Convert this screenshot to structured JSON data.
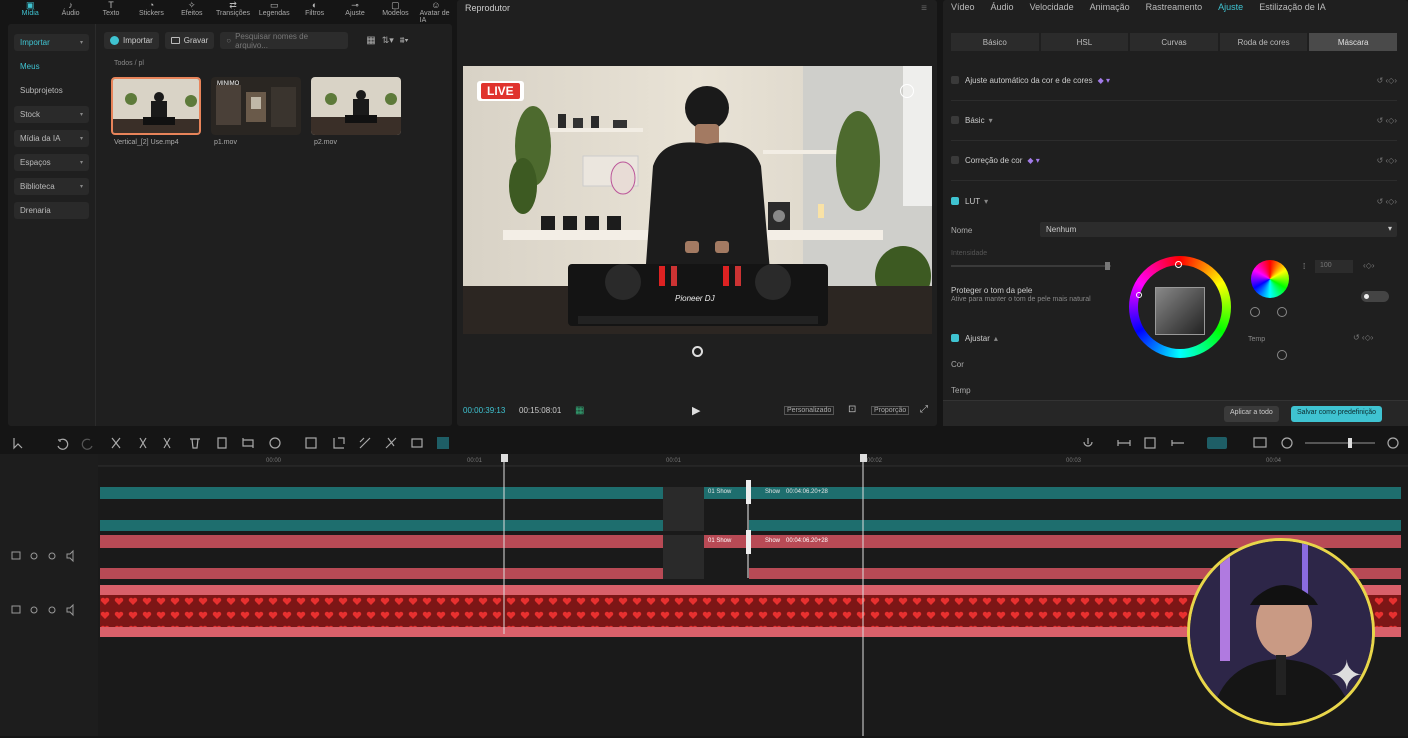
{
  "top_tools": [
    {
      "label": "Mídia",
      "icon": "media-icon",
      "active": true
    },
    {
      "label": "Áudio",
      "icon": "audio-icon"
    },
    {
      "label": "Texto",
      "icon": "text-icon"
    },
    {
      "label": "Stickers",
      "icon": "sticker-icon"
    },
    {
      "label": "Efeitos",
      "icon": "effects-icon"
    },
    {
      "label": "Transições",
      "icon": "transitions-icon"
    },
    {
      "label": "Legendas",
      "icon": "captions-icon"
    },
    {
      "label": "Filtros",
      "icon": "filters-icon"
    },
    {
      "label": "Ajuste",
      "icon": "adjust-icon"
    },
    {
      "label": "Modelos",
      "icon": "templates-icon"
    },
    {
      "label": "Avatar de IA",
      "icon": "ai-avatar-icon"
    }
  ],
  "media_sidebar": [
    {
      "label": "Importar",
      "active": true,
      "box": true,
      "arrow": true
    },
    {
      "label": "Meus",
      "active": true,
      "box": false
    },
    {
      "label": "Subprojetos",
      "box": false
    },
    {
      "label": "Stock",
      "box": true,
      "arrow": true
    },
    {
      "label": "Mídia da IA",
      "box": true,
      "arrow": true
    },
    {
      "label": "Espaços",
      "box": true,
      "arrow": true
    },
    {
      "label": "Biblioteca",
      "box": true,
      "arrow": true
    },
    {
      "label": "Drenaria",
      "box": true
    }
  ],
  "media_bar": {
    "import_label": "Importar",
    "record_label": "Gravar",
    "search_placeholder": "Pesquisar nomes de arquivo..."
  },
  "breadcrumb": {
    "root": "Todos",
    "current": "pl"
  },
  "media_items": [
    {
      "name": "Vertical_[2] Use.mp4",
      "badge": ""
    },
    {
      "name": "p1.mov",
      "badge": "MINIMO"
    },
    {
      "name": "p2.mov",
      "badge": ""
    }
  ],
  "player": {
    "title": "Reprodutor",
    "live_label": "LIVE",
    "deck_brand": "Pioneer DJ",
    "time_current": "00:00:39:13",
    "time_total": "00:15:08:01",
    "full_label": "Personalizado",
    "ratio_label": "Proporção"
  },
  "inspector": {
    "tabs": [
      "Vídeo",
      "Áudio",
      "Velocidade",
      "Animação",
      "Rastreamento",
      "Ajuste",
      "Estilização de IA"
    ],
    "active_tab": "Ajuste",
    "sub_tabs": [
      "Básico",
      "HSL",
      "Curvas",
      "Roda de cores",
      "Máscara"
    ],
    "active_sub": "Máscara",
    "sections": [
      {
        "label": "Ajuste automático da cor e de cores",
        "checked": false
      },
      {
        "label": "Básic",
        "checked": false
      },
      {
        "label": "Correção de cor",
        "checked": false
      },
      {
        "label": "LUT",
        "checked": true
      }
    ],
    "lut_name_label": "Nome",
    "lut_name_value": "Nenhum",
    "intensity_label": "Intensidade",
    "intensity_value": "100",
    "protect_label": "Proteger o tom da pele",
    "protect_desc": "Ative para manter o tom de pele mais natural",
    "adjust_label": "Ajustar",
    "cor_label": "Cor",
    "temp_label": "Temp",
    "temp_label2": "Temp",
    "apply_all": "Aplicar a todo",
    "save_preset": "Salvar como predefinição"
  },
  "ruler": [
    "00:00",
    "00:01",
    "00:01",
    "00:02",
    "00:03",
    "00:04"
  ],
  "tracks": {
    "clip_a_label": "01 Show",
    "clip_b_label": "Show",
    "clip_b_text": "00:04:06.20+28",
    "clip_c_label": "01 Show",
    "clip_d_label": "Show",
    "clip_d_text": "00:04:06.20+28"
  },
  "colors": {
    "accent": "#3fc3d1",
    "teal_clip": "#1e6e6e",
    "red_clip": "#b84a55",
    "heart_track": "#8b1e1e"
  }
}
